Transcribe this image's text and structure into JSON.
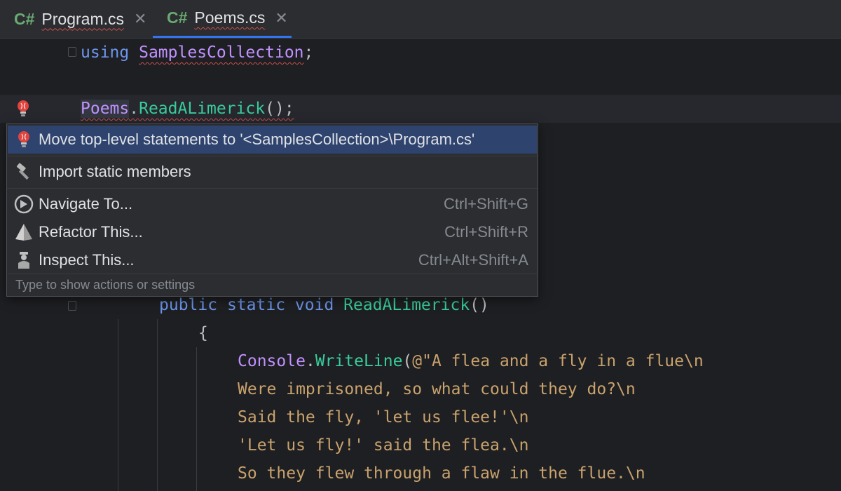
{
  "tabs": [
    {
      "lang": "C#",
      "name": "Program.cs",
      "close": "✕"
    },
    {
      "lang": "C#",
      "name": "Poems.cs",
      "close": "✕"
    }
  ],
  "code": {
    "line1": {
      "kw": "using",
      "ns": "SamplesCollection",
      "end": ";"
    },
    "line2": {
      "cls": "Poems",
      "dot": ".",
      "mth": "ReadALimerick",
      "end": "();"
    },
    "line3": {
      "kw1": "public",
      "kw2": "static",
      "kw3": "void",
      "mth": "ReadALimerick",
      "end": "()"
    },
    "line4": {
      "brace": "{"
    },
    "line5": {
      "cls": "Console",
      "dot": ".",
      "mth": "WriteLine",
      "open": "(",
      "str": "@\"A flea and a fly in a flue\\n"
    },
    "line6": {
      "str": "Were imprisoned, so what could they do?\\n"
    },
    "line7": {
      "str": "Said the fly, 'let us flee!'\\n"
    },
    "line8": {
      "str": "'Let us fly!' said the flea.\\n"
    },
    "line9": {
      "str": "So they flew through a flaw in the flue.\\n"
    }
  },
  "popup": {
    "items": [
      {
        "icon": "bulb-icon",
        "label": "Move top-level statements to '<SamplesCollection>\\Program.cs'",
        "shortcut": ""
      },
      {
        "icon": "hammer-icon",
        "label": "Import static members",
        "shortcut": ""
      },
      {
        "icon": "compass-icon",
        "label": "Navigate To...",
        "shortcut": "Ctrl+Shift+G"
      },
      {
        "icon": "pyramid-icon",
        "label": "Refactor This...",
        "shortcut": "Ctrl+Shift+R"
      },
      {
        "icon": "inspector-icon",
        "label": "Inspect This...",
        "shortcut": "Ctrl+Alt+Shift+A"
      }
    ],
    "footer": "Type to show actions or settings"
  },
  "colors": {
    "background": "#1e1f22",
    "keyword": "#6c95eb",
    "class": "#c191ff",
    "method": "#39cc9b",
    "string": "#c9a26d",
    "selection": "#2e436e",
    "error": "#c94f4f"
  }
}
